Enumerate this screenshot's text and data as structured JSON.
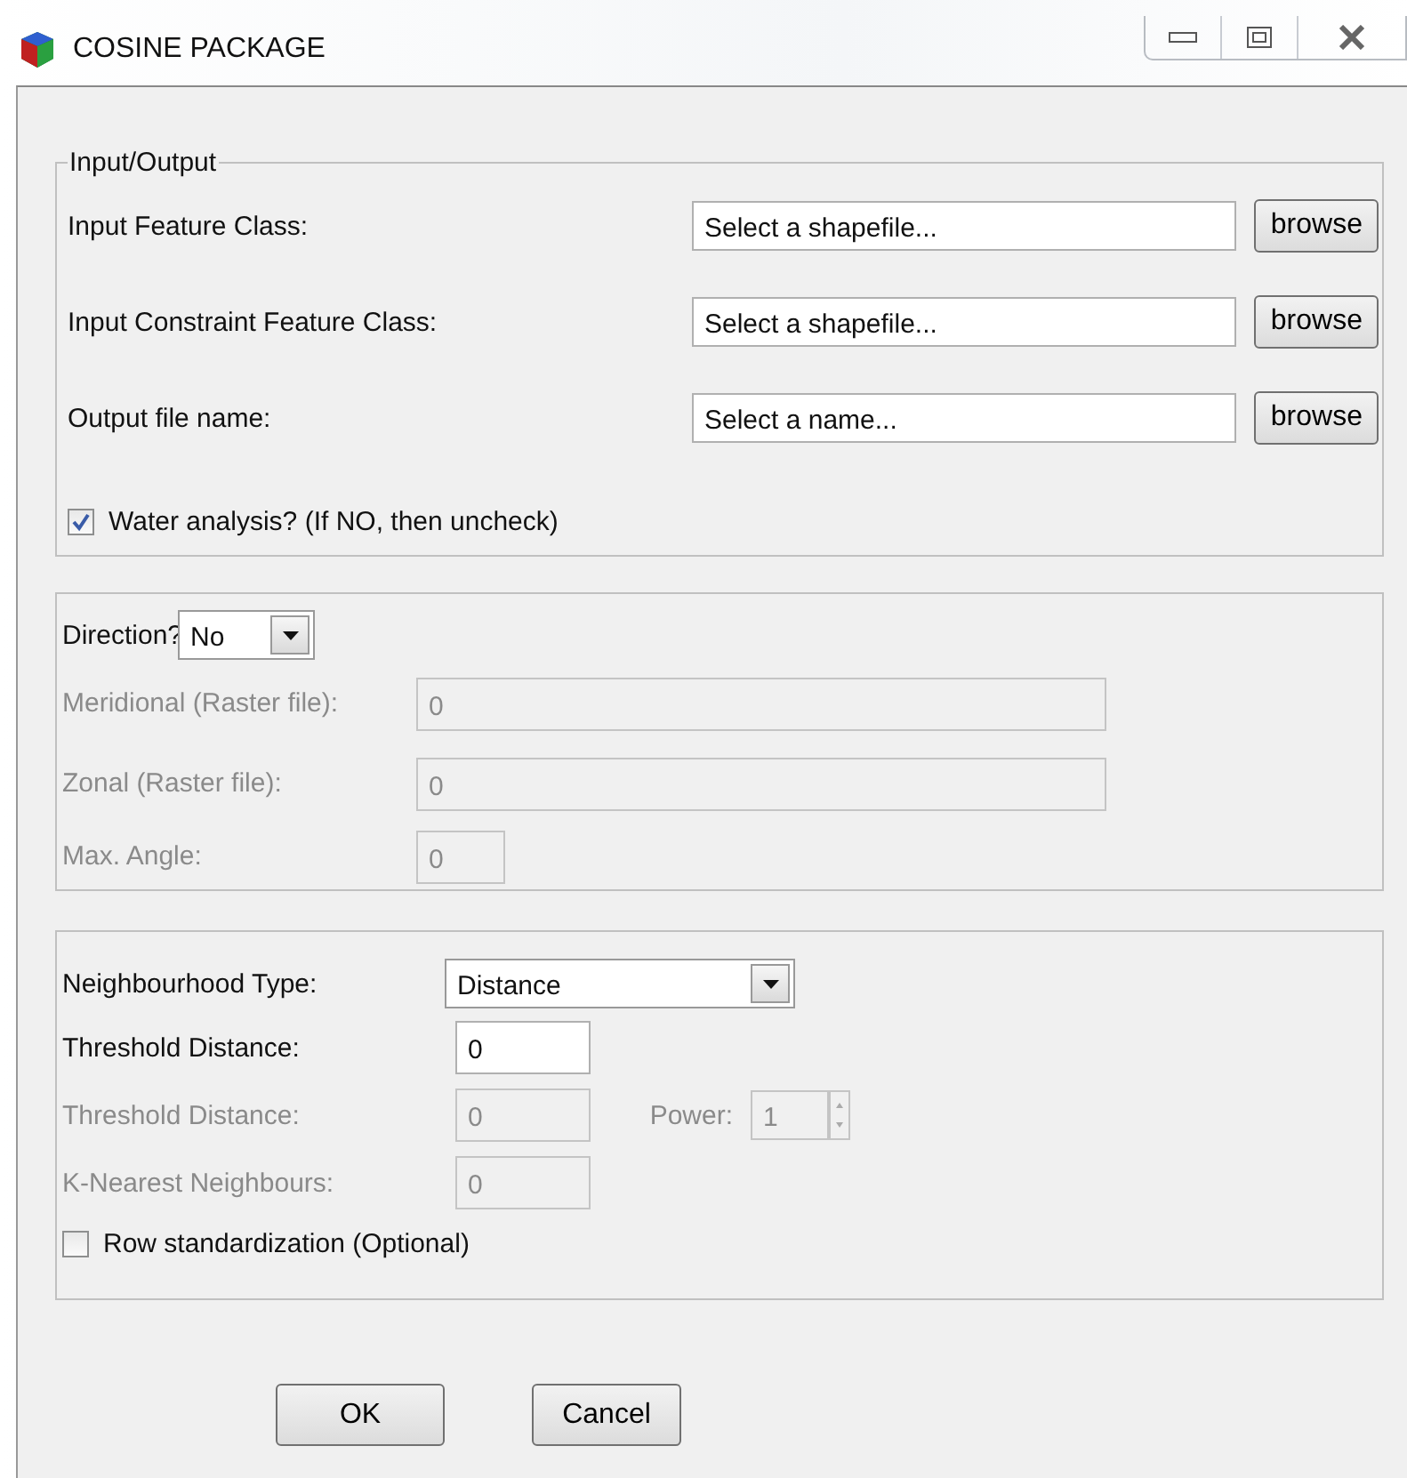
{
  "window": {
    "title": "COSINE PACKAGE"
  },
  "input_output": {
    "legend": "Input/Output",
    "rows": [
      {
        "label": "Input Feature Class:",
        "placeholder": "Select a shapefile...",
        "button": "browse"
      },
      {
        "label": "Input Constraint Feature Class:",
        "placeholder": "Select a shapefile...",
        "button": "browse"
      },
      {
        "label": "Output file name:",
        "placeholder": "Select a name...",
        "button": "browse"
      }
    ],
    "checkbox": {
      "label": "Water analysis? (If NO, then uncheck)",
      "checked": true
    }
  },
  "direction": {
    "label": "Direction?",
    "value": "No",
    "rows": [
      {
        "kind": "long",
        "label": "Meridional (Raster file):",
        "value": "0",
        "disabled": true
      },
      {
        "kind": "long",
        "label": "Zonal (Raster file):",
        "value": "0",
        "disabled": true
      },
      {
        "kind": "short",
        "label": "Max. Angle:",
        "value": "0",
        "disabled": true
      }
    ]
  },
  "neighbourhood": {
    "label": "Neighbourhood Type:",
    "value": "Distance",
    "rows": [
      {
        "kind": "field",
        "label": "Threshold Distance:",
        "value": "0",
        "disabled": false
      },
      {
        "kind": "power",
        "label": "Threshold Distance:",
        "value": "0",
        "disabled": true,
        "power_label": "Power:",
        "power_value": "1"
      },
      {
        "kind": "field",
        "label": "K-Nearest Neighbours:",
        "value": "0",
        "disabled": true
      }
    ],
    "checkbox": {
      "label": "Row standardization (Optional)",
      "checked": false
    }
  },
  "buttons": [
    "OK",
    "Cancel"
  ]
}
